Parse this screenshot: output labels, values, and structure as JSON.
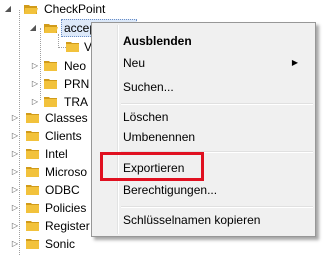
{
  "tree": {
    "root": "CheckPoint",
    "selected": "accepted_sn",
    "truncated_child": "V",
    "children": [
      "Neo",
      "PRN",
      "TRA"
    ],
    "top_level": [
      "Classes",
      "Clients",
      "Intel",
      "Microso",
      "ODBC",
      "Policies",
      "Register",
      "Sonic"
    ]
  },
  "context_menu": {
    "items": {
      "collapse": "Ausblenden",
      "new": "Neu",
      "search": "Suchen...",
      "delete": "Löschen",
      "rename": "Umbenennen",
      "export": "Exportieren",
      "permissions": "Berechtigungen...",
      "copy_key_name": "Schlüsselnamen kopieren"
    },
    "submenu_arrow": "▶",
    "highlight_color": "#e01020"
  },
  "colors": {
    "folder": "#f2c23c",
    "folder_dark": "#d19b1a",
    "selection": "#dde9f9"
  }
}
